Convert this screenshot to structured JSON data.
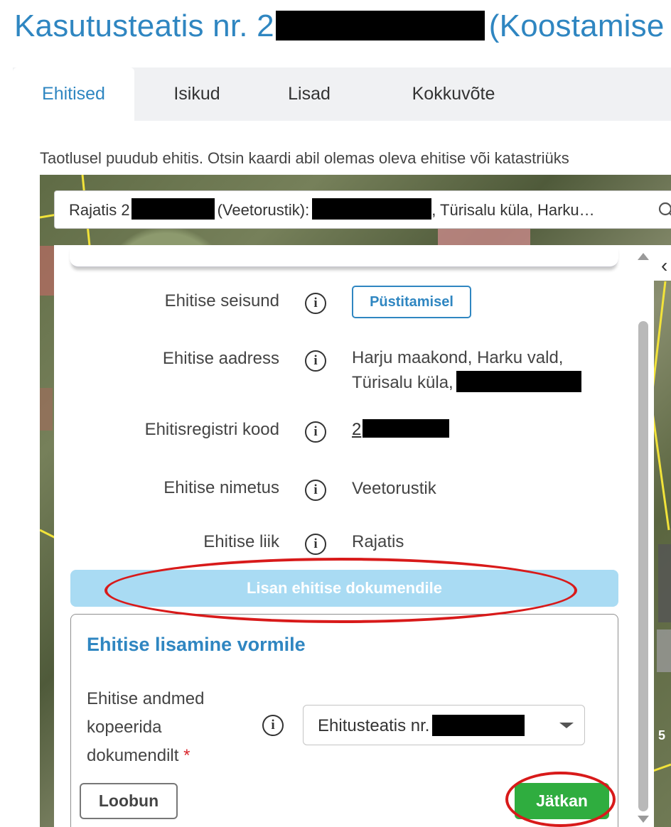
{
  "title": {
    "prefix": "Kasutusteatis nr. 2",
    "suffix": "(Koostamise"
  },
  "tabs": [
    {
      "label": "Ehitised",
      "active": true
    },
    {
      "label": "Isikud",
      "active": false
    },
    {
      "label": "Lisad",
      "active": false
    },
    {
      "label": "Kokkuvõte",
      "active": false
    }
  ],
  "notice": "Taotlusel puudub ehitis. Otsin kaardi abil olemas oleva ehitise või katastriüks",
  "search": {
    "prefix": "Rajatis 2",
    "middle": "(Veetorustik):",
    "suffix": ", Türisalu küla, Harku…"
  },
  "details": {
    "status_label": "Ehitise seisund",
    "status_value": "Püstitamisel",
    "address_label": "Ehitise aadress",
    "address_line1": "Harju maakond, Harku vald,",
    "address_line2": "Türisalu küla,",
    "reg_label": "Ehitisregistri kood",
    "reg_value": "2",
    "name_label": "Ehitise nimetus",
    "name_value": "Veetorustik",
    "type_label": "Ehitise liik",
    "type_value": "Rajatis",
    "info_glyph": "i"
  },
  "add_button": "Lisan ehitise dokumendile",
  "form": {
    "heading": "Ehitise lisamine vormile",
    "label": "Ehitise andmed kopeerida dokumendilt",
    "required_mark": "*",
    "select_value": "Ehitusteatis nr.",
    "cancel": "Loobun",
    "continue": "Jätkan"
  },
  "map_labels": {
    "label_5": "5"
  },
  "colors": {
    "accent": "#2f86c1",
    "success": "#2fad3f",
    "disabled_button": "#a9dbf3",
    "annotation": "#d81a1a"
  },
  "icons": {
    "info": "info-circle-icon",
    "search": "search-icon",
    "chevron": "chevron-left-icon",
    "dropdown": "chevron-down-icon"
  }
}
